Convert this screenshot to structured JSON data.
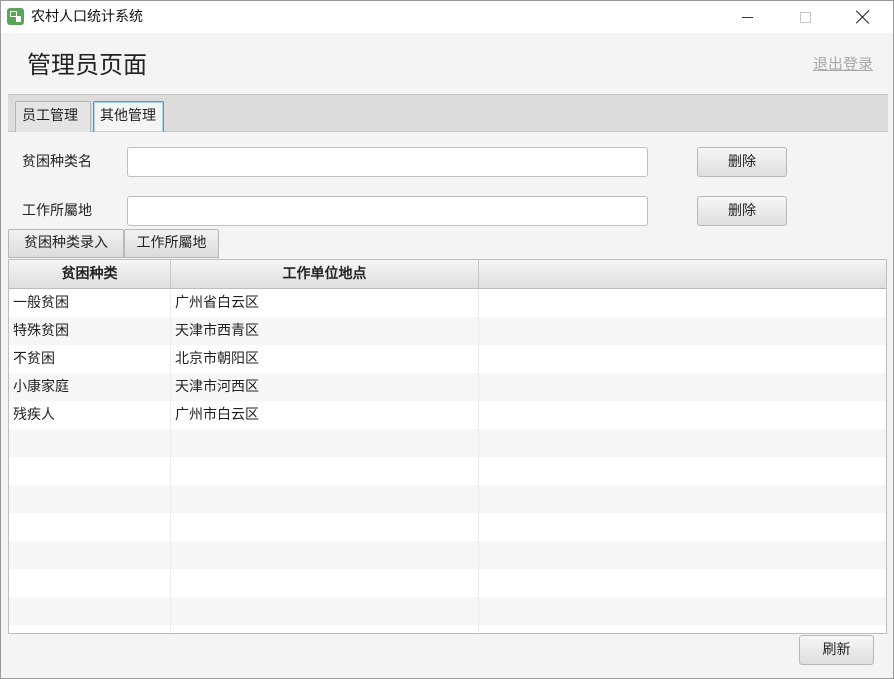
{
  "window": {
    "app_title": "农村人口统计系统"
  },
  "header": {
    "page_title": "管理员页面",
    "logout_label": "退出登录"
  },
  "tabs": [
    {
      "label": "员工管理",
      "selected": false
    },
    {
      "label": "其他管理",
      "selected": true
    }
  ],
  "form": {
    "poverty_type_label": "贫困种类名",
    "poverty_type_value": "",
    "workplace_label": "工作所屬地",
    "workplace_value": "",
    "delete_label_1": "删除",
    "delete_label_2": "删除"
  },
  "subtabs": [
    {
      "label": "贫困种类录入"
    },
    {
      "label": "工作所屬地"
    }
  ],
  "table": {
    "columns": [
      "贫困种类",
      "工作单位地点",
      ""
    ],
    "rows": [
      [
        "一般贫困",
        "广州省白云区"
      ],
      [
        "特殊贫困",
        "天津市西青区"
      ],
      [
        "不贫困",
        "北京市朝阳区"
      ],
      [
        "小康家庭",
        "天津市河西区"
      ],
      [
        "残疾人",
        "广州市白云区"
      ],
      [
        "",
        ""
      ],
      [
        "",
        ""
      ],
      [
        "",
        ""
      ],
      [
        "",
        ""
      ],
      [
        "",
        ""
      ],
      [
        "",
        ""
      ],
      [
        "",
        ""
      ],
      [
        "",
        ""
      ]
    ]
  },
  "footer": {
    "refresh_label": "刷新"
  }
}
